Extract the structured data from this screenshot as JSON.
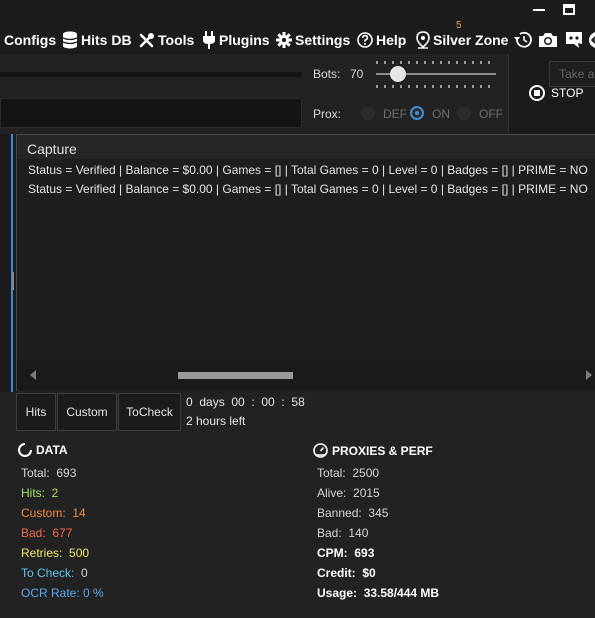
{
  "menu": {
    "configs": "Configs",
    "hits_db": "Hits DB",
    "tools": "Tools",
    "plugins": "Plugins",
    "settings": "Settings",
    "help": "Help",
    "silver_zone": "Silver Zone",
    "silver_zone_badge": "5"
  },
  "controls": {
    "bots_label": "Bots:",
    "bots_value": "70",
    "bots_slider_level": 70,
    "prox_label": "Prox:",
    "prox_options": [
      "DEF",
      "ON",
      "OFF"
    ],
    "prox_selected": "ON",
    "take_placeholder": "Take a",
    "stop_label": "STOP"
  },
  "capture": {
    "title": "Capture",
    "lines": [
      "Status = Verified | Balance = $0.00 | Games = [] | Total Games = 0 | Level = 0 | Badges = [] | PRIME = NO",
      "Status = Verified | Balance = $0.00 | Games = [] | Total Games = 0 | Level = 0 | Badges = [] | PRIME = NO"
    ]
  },
  "tabs": [
    "Hits",
    "Custom",
    "ToCheck"
  ],
  "timer": {
    "elapsed": "0  days  00  :  00  :  58",
    "remaining": "2 hours left"
  },
  "data_section": {
    "title": "DATA",
    "rows": [
      {
        "label": "Total:",
        "value": "693",
        "color": "#d6d6d6"
      },
      {
        "label": "Hits:",
        "value": "2",
        "color": "#a8e063"
      },
      {
        "label": "Custom:",
        "value": "14",
        "color": "#f08a3c"
      },
      {
        "label": "Bad:",
        "value": "677",
        "color": "#f06a4a"
      },
      {
        "label": "Retries:",
        "value": "500",
        "color": "#f5e66a"
      },
      {
        "label": "To Check:",
        "value": "0",
        "color": "#62c4e8"
      },
      {
        "label": "OCR Rate:",
        "value": "0 %",
        "color": "#5aa8f0"
      }
    ]
  },
  "proxies_section": {
    "title": "PROXIES & PERF",
    "rows": [
      {
        "label": "Total:",
        "value": "2500"
      },
      {
        "label": "Alive:",
        "value": "2015"
      },
      {
        "label": "Banned:",
        "value": "345"
      },
      {
        "label": "Bad:",
        "value": "140"
      },
      {
        "label": "CPM:",
        "value": "693"
      },
      {
        "label": "Credit:",
        "value": "$0"
      },
      {
        "label": "Usage:",
        "value": "33.58/444 MB"
      }
    ]
  }
}
